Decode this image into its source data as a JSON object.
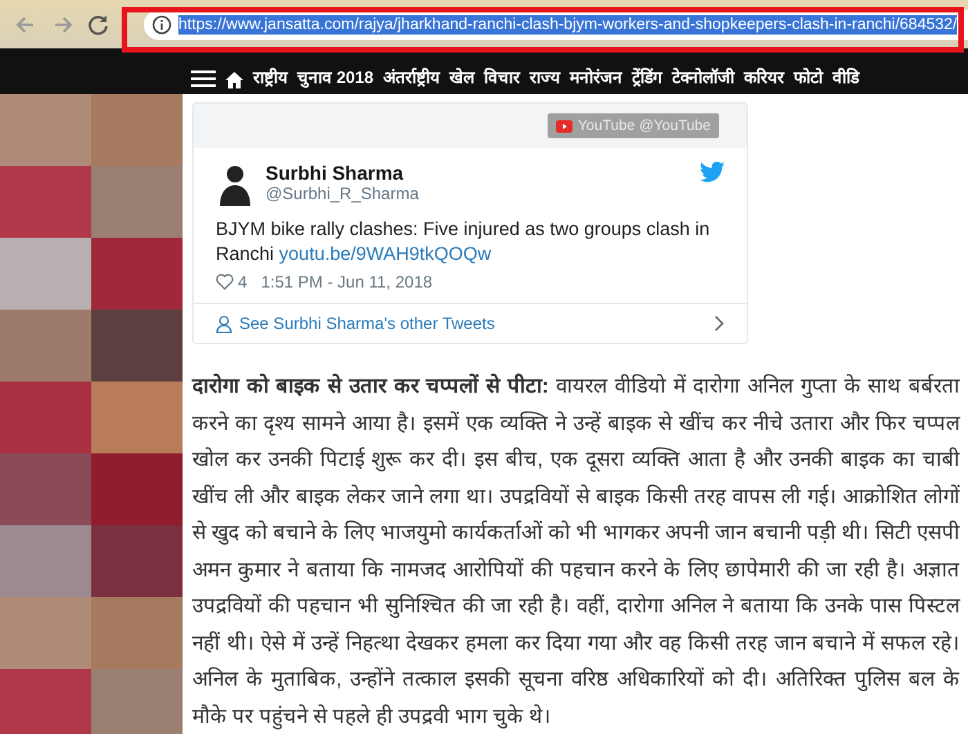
{
  "browser": {
    "url": "https://www.jansatta.com/rajya/jharkhand-ranchi-clash-bjym-workers-and-shopkeepers-clash-in-ranchi/684532/"
  },
  "nav": {
    "items": [
      "राष्ट्रीय",
      "चुनाव 2018",
      "अंतर्राष्ट्रीय",
      "खेल",
      "विचार",
      "राज्य",
      "मनोरंजन",
      "ट्रेंडिंग",
      "टेक्नोलॉजी",
      "करियर",
      "फोटो",
      "वीडि"
    ]
  },
  "video_badge": "YouTube @YouTube",
  "tweet": {
    "name": "Surbhi Sharma",
    "handle": "@Surbhi_R_Sharma",
    "text": "BJYM bike rally clashes: Five injured as two groups clash in Ranchi",
    "link": "youtu.be/9WAH9tkQOQw",
    "likes": "4",
    "time": "1:51 PM - Jun 11, 2018",
    "more": "See Surbhi Sharma's other Tweets"
  },
  "article": "**दारोगा को बाइक से उतार कर चप्पलों से पीटा:** वायरल वीडियो में दारोगा अनिल गुप्ता के साथ बर्बरता करने का दृश्य सामने आया है। इसमें एक व्यक्ति ने उन्हें बाइक से खींच कर नीचे उतारा और फिर चप्पल खोल कर उनकी पिटाई शुरू कर दी। इस बीच, एक दूसरा व्यक्ति आता है और उनकी बाइक का चाबी खींच ली और बाइक लेकर जाने लगा था। उपद्रवियों से बाइक किसी तरह वापस ली गई। आक्रोशित लोगों से खुद को बचाने के लिए भाजयुमो कार्यकर्ताओं को भी भागकर अपनी जान बचानी पड़ी थी। सिटी एसपी अमन कुमार ने बताया कि नामजद आरोपियों की पहचान करने के लिए छापेमारी की जा रही है। अज्ञात उपद्रवियों की पहचान भी सुनिश्चित की जा रही है। वहीं, दारोगा अनिल ने बताया कि उनके पास पिस्टल नहीं थी। ऐसे में उन्हें निहत्था देखकर हमला कर दिया गया और वह किसी तरह जान बचाने में सफल रहे। अनिल के मुताबिक, उन्होंने तत्काल इसकी सूचना वरिष्ठ अधिकारियों को दी। अतिरिक्त पुलिस बल के मौके पर पहुंचने से पहले ही उपद्रवी भाग चुके थे।"
}
